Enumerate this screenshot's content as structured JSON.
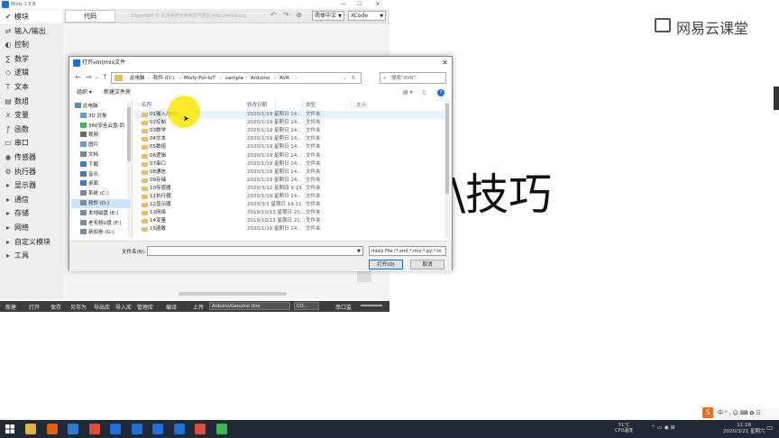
{
  "app": {
    "title": "Mixly 1.0.8",
    "window_controls": [
      "—",
      "☐",
      "✕"
    ]
  },
  "sidebar": {
    "items": [
      {
        "icon": "✔",
        "label": "模块"
      },
      {
        "icon": "⇄",
        "label": "输入/输出"
      },
      {
        "icon": "◐",
        "label": "控制"
      },
      {
        "icon": "∑",
        "label": "数学"
      },
      {
        "icon": "◇",
        "label": "逻辑"
      },
      {
        "icon": "T",
        "label": "文本"
      },
      {
        "icon": "▤",
        "label": "数组"
      },
      {
        "icon": "x",
        "label": "变量"
      },
      {
        "icon": "ƒ",
        "label": "函数"
      },
      {
        "icon": "▭",
        "label": "串口"
      },
      {
        "icon": "◉",
        "label": "传感器"
      },
      {
        "icon": "⚙",
        "label": "执行器"
      },
      {
        "icon": "▸",
        "label": "显示器"
      },
      {
        "icon": "▸",
        "label": "通信"
      },
      {
        "icon": "▸",
        "label": "存储"
      },
      {
        "icon": "▸",
        "label": "网络"
      },
      {
        "icon": "▸",
        "label": "自定义模块"
      },
      {
        "icon": "▸",
        "label": "工具"
      }
    ]
  },
  "toolbar_top": {
    "code_tab": "代码",
    "copyright": "Copyright © 北京师范大学米思齐团队 http://mixly.org",
    "language": "简体中文",
    "theme": "XCode"
  },
  "bottombar": {
    "buttons": [
      "新建",
      "打开",
      "保存",
      "另存为",
      "导出库",
      "导入库",
      "管理库",
      "编译",
      "上传"
    ],
    "board": "Arduino/Genuino Uno",
    "port": "CO...",
    "serial_monitor": "串口监"
  },
  "right": {
    "brand": "网易云课堂",
    "big_text": "\\技巧"
  },
  "dialog": {
    "title": "打开xml/mix文件",
    "close": "✕",
    "breadcrumbs": [
      "此电脑",
      "软件 (D:)",
      "Mixly-For-IoT",
      "sample",
      "Arduino",
      "AVR"
    ],
    "search_placeholder": "搜索\"AVR\"",
    "organize": "组织 ▾",
    "new_folder": "新建文件夹",
    "tree": [
      {
        "label": "此电脑",
        "color": "#4a90d9"
      },
      {
        "label": "3D 对象",
        "color": "#5aa0e0"
      },
      {
        "label": "360安全云盘-同",
        "color": "#3fb34f"
      },
      {
        "label": "视频",
        "color": "#6b6b6b"
      },
      {
        "label": "图片",
        "color": "#5aa0e0"
      },
      {
        "label": "文档",
        "color": "#7a8a9a"
      },
      {
        "label": "下载",
        "color": "#3b7bd1"
      },
      {
        "label": "音乐",
        "color": "#3b7bd1"
      },
      {
        "label": "桌面",
        "color": "#3b7bd1"
      },
      {
        "label": "系统 (C:)",
        "color": "#7a8a9a"
      },
      {
        "label": "软件 (D:)",
        "color": "#7a8a9a",
        "selected": true
      },
      {
        "label": "本地磁盘 (E:)",
        "color": "#7a8a9a"
      },
      {
        "label": "老毛桃U盘 (F:)",
        "color": "#7a8a9a"
      },
      {
        "label": "新加卷 (G:)",
        "color": "#7a8a9a"
      }
    ],
    "columns": [
      "名称",
      "修改日期",
      "类型",
      "大小"
    ],
    "files": [
      {
        "name": "01输入/输出",
        "date": "2020/1/19 星期日 14...",
        "type": "文件夹",
        "hover": true
      },
      {
        "name": "02控制",
        "date": "2020/1/19 星期日 14...",
        "type": "文件夹"
      },
      {
        "name": "03数学",
        "date": "2020/1/19 星期日 14...",
        "type": "文件夹"
      },
      {
        "name": "04文本",
        "date": "2020/1/19 星期日 14...",
        "type": "文件夹"
      },
      {
        "name": "05数组",
        "date": "2020/1/19 星期日 14...",
        "type": "文件夹"
      },
      {
        "name": "06逻辑",
        "date": "2020/1/19 星期日 14...",
        "type": "文件夹"
      },
      {
        "name": "07串口",
        "date": "2020/1/19 星期日 14...",
        "type": "文件夹"
      },
      {
        "name": "08通信",
        "date": "2020/1/19 星期日 14...",
        "type": "文件夹"
      },
      {
        "name": "09存储",
        "date": "2020/1/19 星期日 14...",
        "type": "文件夹"
      },
      {
        "name": "10传感器",
        "date": "2020/3/12 星期四 9:13",
        "type": "文件夹"
      },
      {
        "name": "11执行器",
        "date": "2020/1/19 星期日 14...",
        "type": "文件夹"
      },
      {
        "name": "12显示器",
        "date": "2020/3/1 星期日 14:11",
        "type": "文件夹"
      },
      {
        "name": "13网络",
        "date": "2019/10/13 星期日 21...",
        "type": "文件夹"
      },
      {
        "name": "14变量",
        "date": "2019/10/13 星期日 21...",
        "type": "文件夹"
      },
      {
        "name": "15函数",
        "date": "2020/1/19 星期日 14...",
        "type": "文件夹"
      }
    ],
    "filename_label": "文件名(N):",
    "filename_value": "",
    "filter": "mixly File (*.xml;*.mix;*.py;*.in",
    "open_button": "打开(O)",
    "cancel_button": "取消"
  },
  "taskbar": {
    "temp": "51°C",
    "temp_label": "CPU温度",
    "time": "11:18",
    "date": "2020/3/21 星期六",
    "ime": "中 ° , ☺ ⌨ ✿ ☷",
    "apps": [
      {
        "name": "explorer",
        "color": "#e3b341"
      },
      {
        "name": "firefox",
        "color": "#e66000"
      },
      {
        "name": "browser",
        "color": "#2a7fd4"
      },
      {
        "name": "browser2",
        "color": "#e04e39"
      },
      {
        "name": "mixly1",
        "color": "#1e6fd9"
      },
      {
        "name": "mixly2",
        "color": "#1e6fd9"
      },
      {
        "name": "mixly3",
        "color": "#1e6fd9"
      },
      {
        "name": "mixly4",
        "color": "#1e6fd9"
      },
      {
        "name": "app-red",
        "color": "#e04e39"
      },
      {
        "name": "app-green",
        "color": "#3fb34f"
      }
    ]
  }
}
